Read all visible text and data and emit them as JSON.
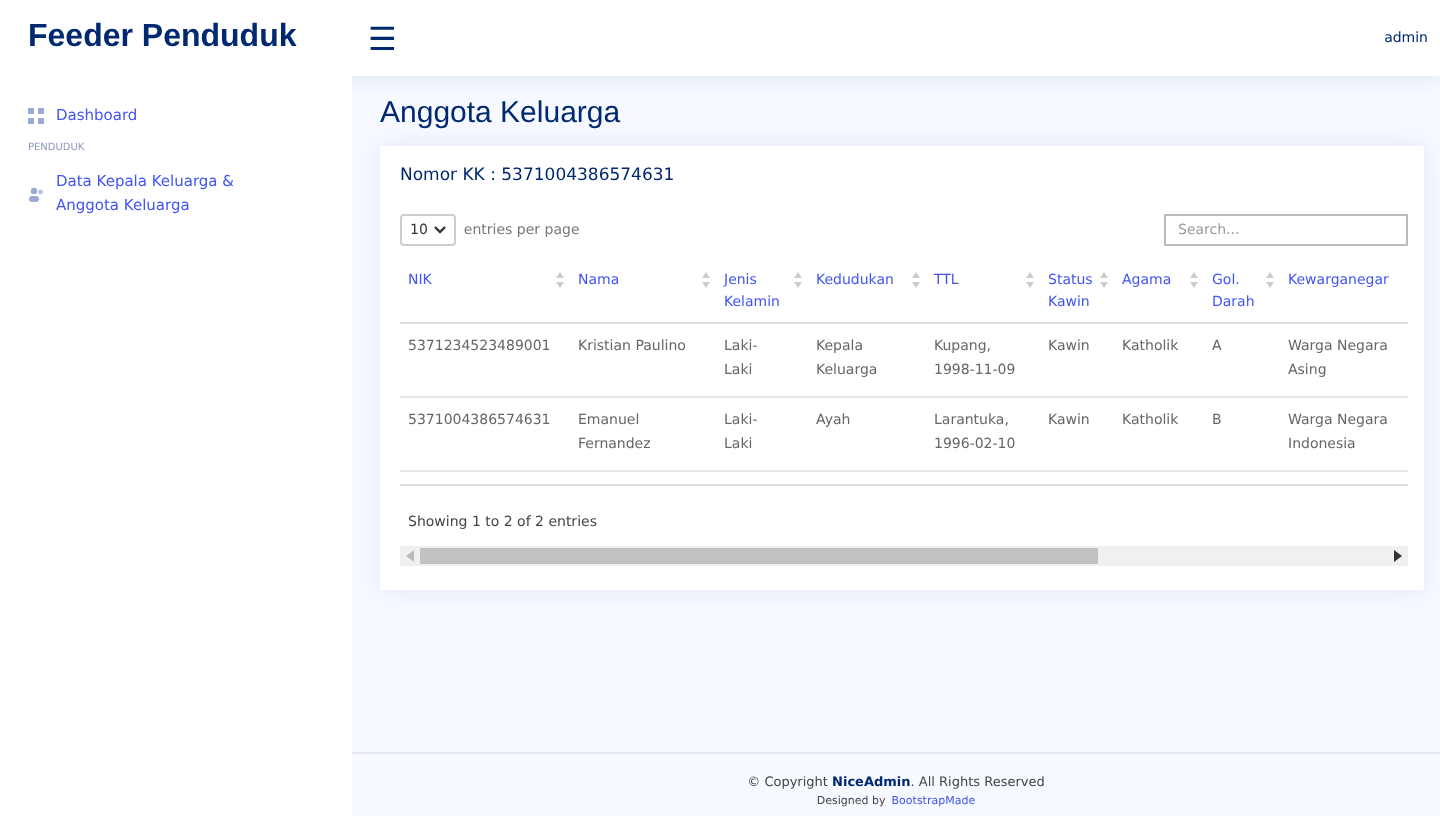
{
  "header": {
    "brand": "Feeder Penduduk",
    "menu_toggle": "☰",
    "user": "admin"
  },
  "sidebar": {
    "items": [
      {
        "kind": "link",
        "label": "Dashboard"
      },
      {
        "kind": "heading",
        "label": "PENDUDUK"
      },
      {
        "kind": "link",
        "label": "Data Kepala Keluarga & Anggota Keluarga"
      }
    ]
  },
  "page_title": "Anggota Keluarga",
  "card": {
    "title": "Nomor KK : 5371004386574631",
    "page_length": "10",
    "page_length_suffix": "entries per page",
    "search": {
      "placeholder": "Search..."
    },
    "table": {
      "columns": [
        "NIK",
        "Nama",
        "Jenis Kelamin",
        "Kedudukan",
        "TTL",
        "Status Kawin",
        "Agama",
        "Gol. Darah",
        "Kewarganegar"
      ],
      "rows": [
        [
          "5371234523489001",
          "Kristian Paulino",
          "Laki-Laki",
          "Kepala Keluarga",
          "Kupang, 1998-11-09",
          "Kawin",
          "Katholik",
          "A",
          "Warga Negara Asing"
        ],
        [
          "5371004386574631",
          "Emanuel Fernandez",
          "Laki-Laki",
          "Ayah",
          "Larantuka, 1996-02-10",
          "Kawin",
          "Katholik",
          "B",
          "Warga Negara Indonesia"
        ]
      ]
    },
    "info": "Showing 1 to 2 of 2 entries"
  },
  "footer": {
    "copyright": "© Copyright **NiceAdmin**. All Rights Reserved",
    "credit_prefix": "Designed by",
    "credit_link": "BootstrapMade"
  }
}
